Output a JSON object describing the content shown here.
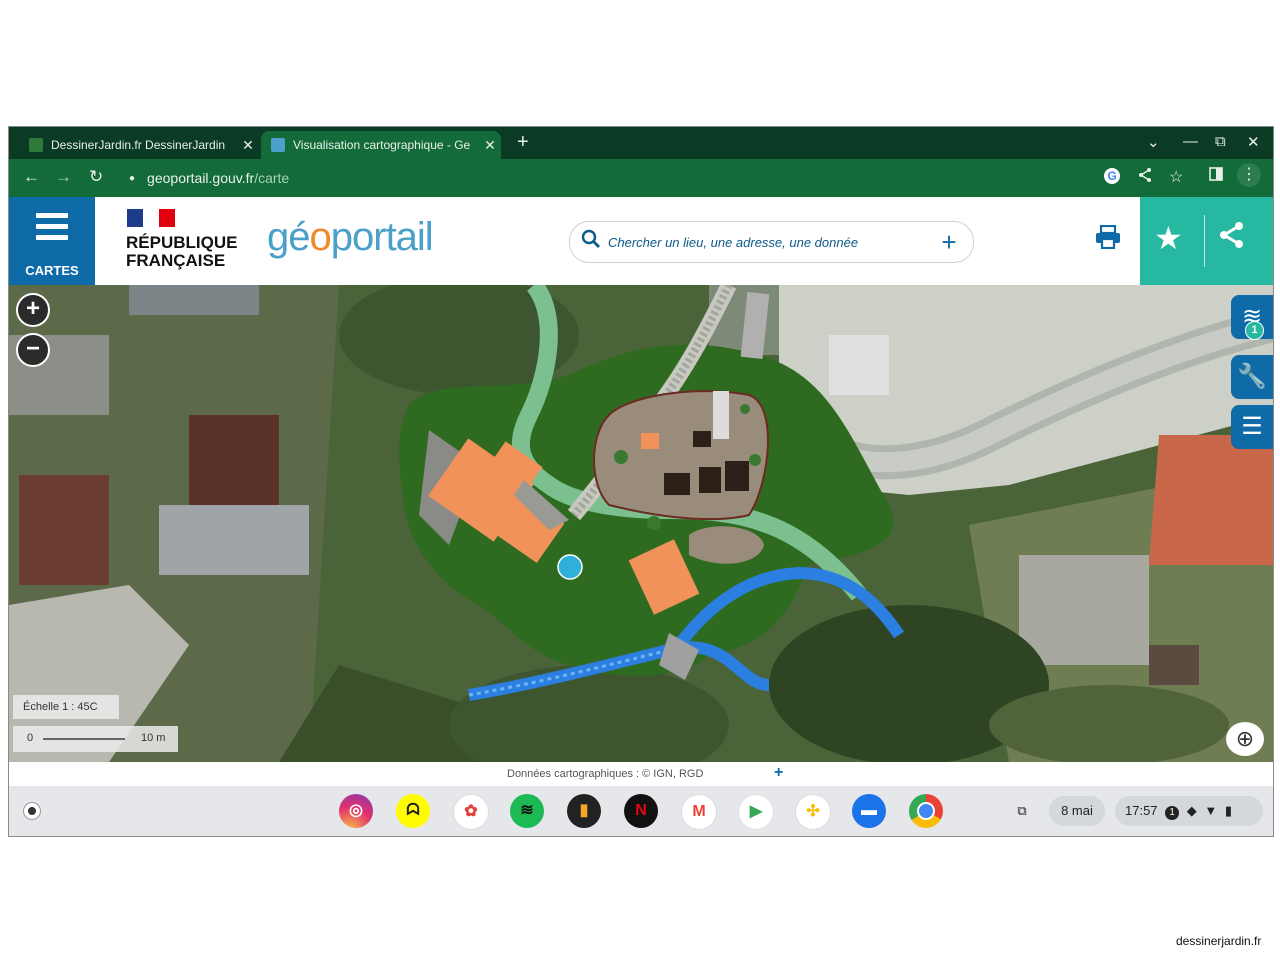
{
  "browser": {
    "tabs": [
      {
        "title": "DessinerJardin.fr DessinerJardin",
        "close": "✕"
      },
      {
        "title": "Visualisation cartographique - Ge",
        "close": "✕"
      }
    ],
    "new_tab": "+",
    "window_controls": {
      "dropdown": "⌄",
      "minimize": "—",
      "restore": "⧉",
      "close": "✕"
    },
    "nav": {
      "back": "←",
      "forward": "→",
      "reload": "↻"
    },
    "url_host": "geoportail.gouv.fr",
    "url_path": "/carte"
  },
  "header": {
    "menu_label": "CARTES",
    "rf_line1": "RÉPUBLIQUE",
    "rf_line2": "FRANÇAISE",
    "logo_geo": "gé",
    "logo_o": "o",
    "logo_portail": "portail",
    "search_placeholder": "Chercher un lieu, une adresse, une donnée"
  },
  "map": {
    "layers_count": "1",
    "scale_label": "Échelle 1 : 45C",
    "scale_zero": "0",
    "scale_length": "10 m"
  },
  "attribution": {
    "text": "Données cartographiques : ©      IGN,  RGD"
  },
  "shelf": {
    "date": "8 mai",
    "time": "17:57",
    "notification_count": "1",
    "apps": [
      "instagram-icon",
      "snapchat-icon",
      "app-icon",
      "spotify-icon",
      "deezer-icon",
      "netflix-icon",
      "gmail-icon",
      "play-store-icon",
      "photos-icon",
      "files-icon",
      "chrome-icon"
    ]
  },
  "caption": "dessinerjardin.fr",
  "colors": {
    "tab_strip": "#0b3b24",
    "toolbar": "#146b3a",
    "cartes_blue": "#0e6ba8",
    "teal": "#26b8a1",
    "garden_green": "#2e6b20",
    "path_green": "#7cc08f",
    "building_orange": "#f0925a",
    "stream_blue": "#2a7fe0"
  }
}
